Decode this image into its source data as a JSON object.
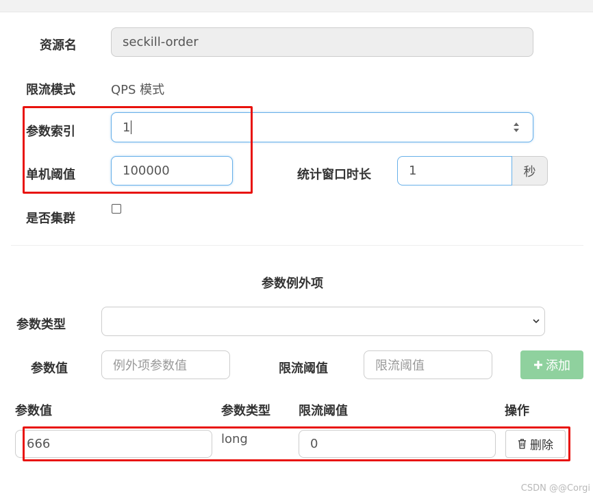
{
  "form": {
    "resource_label": "资源名",
    "resource_value": "seckill-order",
    "mode_label": "限流模式",
    "mode_value": "QPS 模式",
    "param_index_label": "参数索引",
    "param_index_value": "1",
    "threshold_label": "单机阈值",
    "threshold_value": "100000",
    "window_label": "统计窗口时长",
    "window_value": "1",
    "window_unit": "秒",
    "cluster_label": "是否集群",
    "cluster_checked": false
  },
  "exceptions": {
    "title": "参数例外项",
    "type_label": "参数类型",
    "type_value": "",
    "value_label": "参数值",
    "value_placeholder": "例外项参数值",
    "threshold_label": "限流阈值",
    "threshold_placeholder": "限流阈值",
    "add_button": "添加",
    "table": {
      "headers": [
        "参数值",
        "参数类型",
        "限流阈值",
        "操作"
      ],
      "rows": [
        {
          "value": "666",
          "type": "long",
          "threshold": "0",
          "action": "删除"
        }
      ]
    }
  },
  "watermark": "CSDN @@Corgi",
  "colors": {
    "highlight": "#e8120c",
    "focus_border": "#66afe9",
    "add_button_bg": "#8fd19e"
  },
  "icons": {
    "spinner": "spinner-updown-icon",
    "dropdown": "chevron-down-icon",
    "add": "plus-icon",
    "delete": "trash-icon"
  }
}
